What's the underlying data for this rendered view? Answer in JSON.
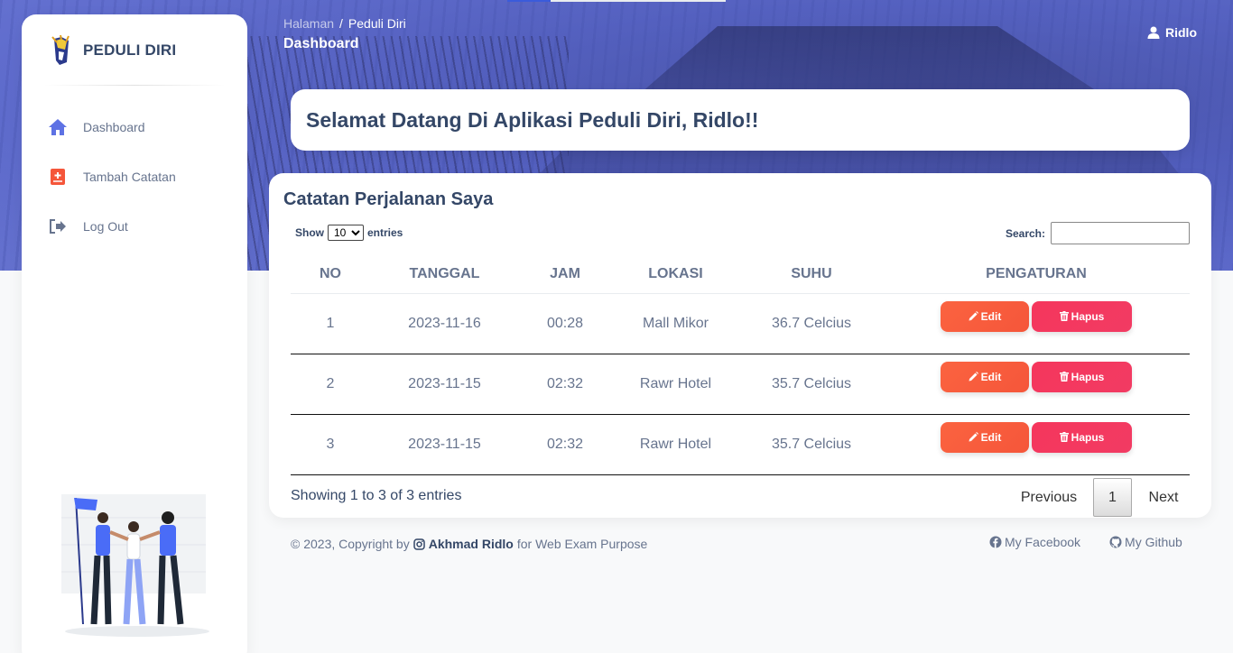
{
  "brand": {
    "name": "PEDULI DIRI"
  },
  "sidebar": {
    "items": [
      {
        "label": "Dashboard",
        "icon": "home-icon"
      },
      {
        "label": "Tambah Catatan",
        "icon": "add-note-icon"
      },
      {
        "label": "Log Out",
        "icon": "logout-icon"
      }
    ]
  },
  "header": {
    "breadcrumb_root": "Halaman",
    "breadcrumb_sep": "/",
    "breadcrumb_current": "Peduli Diri",
    "title": "Dashboard",
    "user": "Ridlo"
  },
  "welcome": {
    "text": "Selamat Datang Di Aplikasi Peduli Diri, Ridlo!!"
  },
  "table_card": {
    "title": "Catatan Perjalanan Saya",
    "show_label": "Show",
    "entries_label": "entries",
    "page_size": "10",
    "search_label": "Search:",
    "search_value": "",
    "columns": [
      "NO",
      "TANGGAL",
      "JAM",
      "LOKASI",
      "SUHU",
      "PENGATURAN"
    ],
    "rows": [
      {
        "no": "1",
        "tanggal": "2023-11-16",
        "jam": "00:28",
        "lokasi": "Mall Mikor",
        "suhu": "36.7 Celcius"
      },
      {
        "no": "2",
        "tanggal": "2023-11-15",
        "jam": "02:32",
        "lokasi": "Rawr Hotel",
        "suhu": "35.7 Celcius"
      },
      {
        "no": "3",
        "tanggal": "2023-11-15",
        "jam": "02:32",
        "lokasi": "Rawr Hotel",
        "suhu": "35.7 Celcius"
      }
    ],
    "edit_label": "Edit",
    "delete_label": "Hapus",
    "info": "Showing 1 to 3 of 3 entries",
    "pagination": {
      "previous": "Previous",
      "current": "1",
      "next": "Next"
    }
  },
  "footer": {
    "copyright": "© 2023, Copyright by",
    "author": "Akhmad Ridlo",
    "purpose": "for Web Exam Purpose",
    "facebook": "My Facebook",
    "github": "My Github"
  },
  "colors": {
    "primary_text": "#344767",
    "muted_text": "#67748e",
    "edit_button": "#fb6340",
    "delete_button": "#f5365c",
    "hero": "#6872c8"
  }
}
